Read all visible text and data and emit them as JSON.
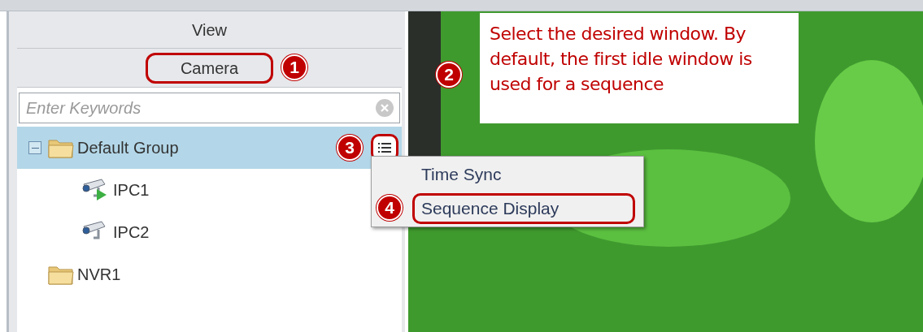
{
  "panel": {
    "header": "View",
    "tab": {
      "label": "Camera",
      "annotated": true,
      "badge": "1"
    },
    "search": {
      "placeholder": "Enter Keywords"
    },
    "tree": [
      {
        "label": "Default Group",
        "kind": "folder",
        "expanded": true,
        "selected": true,
        "badge": "3",
        "children": [
          {
            "label": "IPC1",
            "kind": "camera",
            "playing": true,
            "selected": false
          },
          {
            "label": "IPC2",
            "kind": "camera",
            "playing": false,
            "selected": false
          }
        ]
      },
      {
        "label": "NVR1",
        "kind": "folder",
        "selected": false
      }
    ]
  },
  "context_menu": {
    "items": [
      {
        "label": "Time Sync",
        "annotated": false
      },
      {
        "label": "Sequence Display",
        "annotated": true,
        "badge": "4"
      }
    ]
  },
  "callout": {
    "badge": "2",
    "text": "Select the desired window. By default, the first idle window is used for a sequence"
  }
}
